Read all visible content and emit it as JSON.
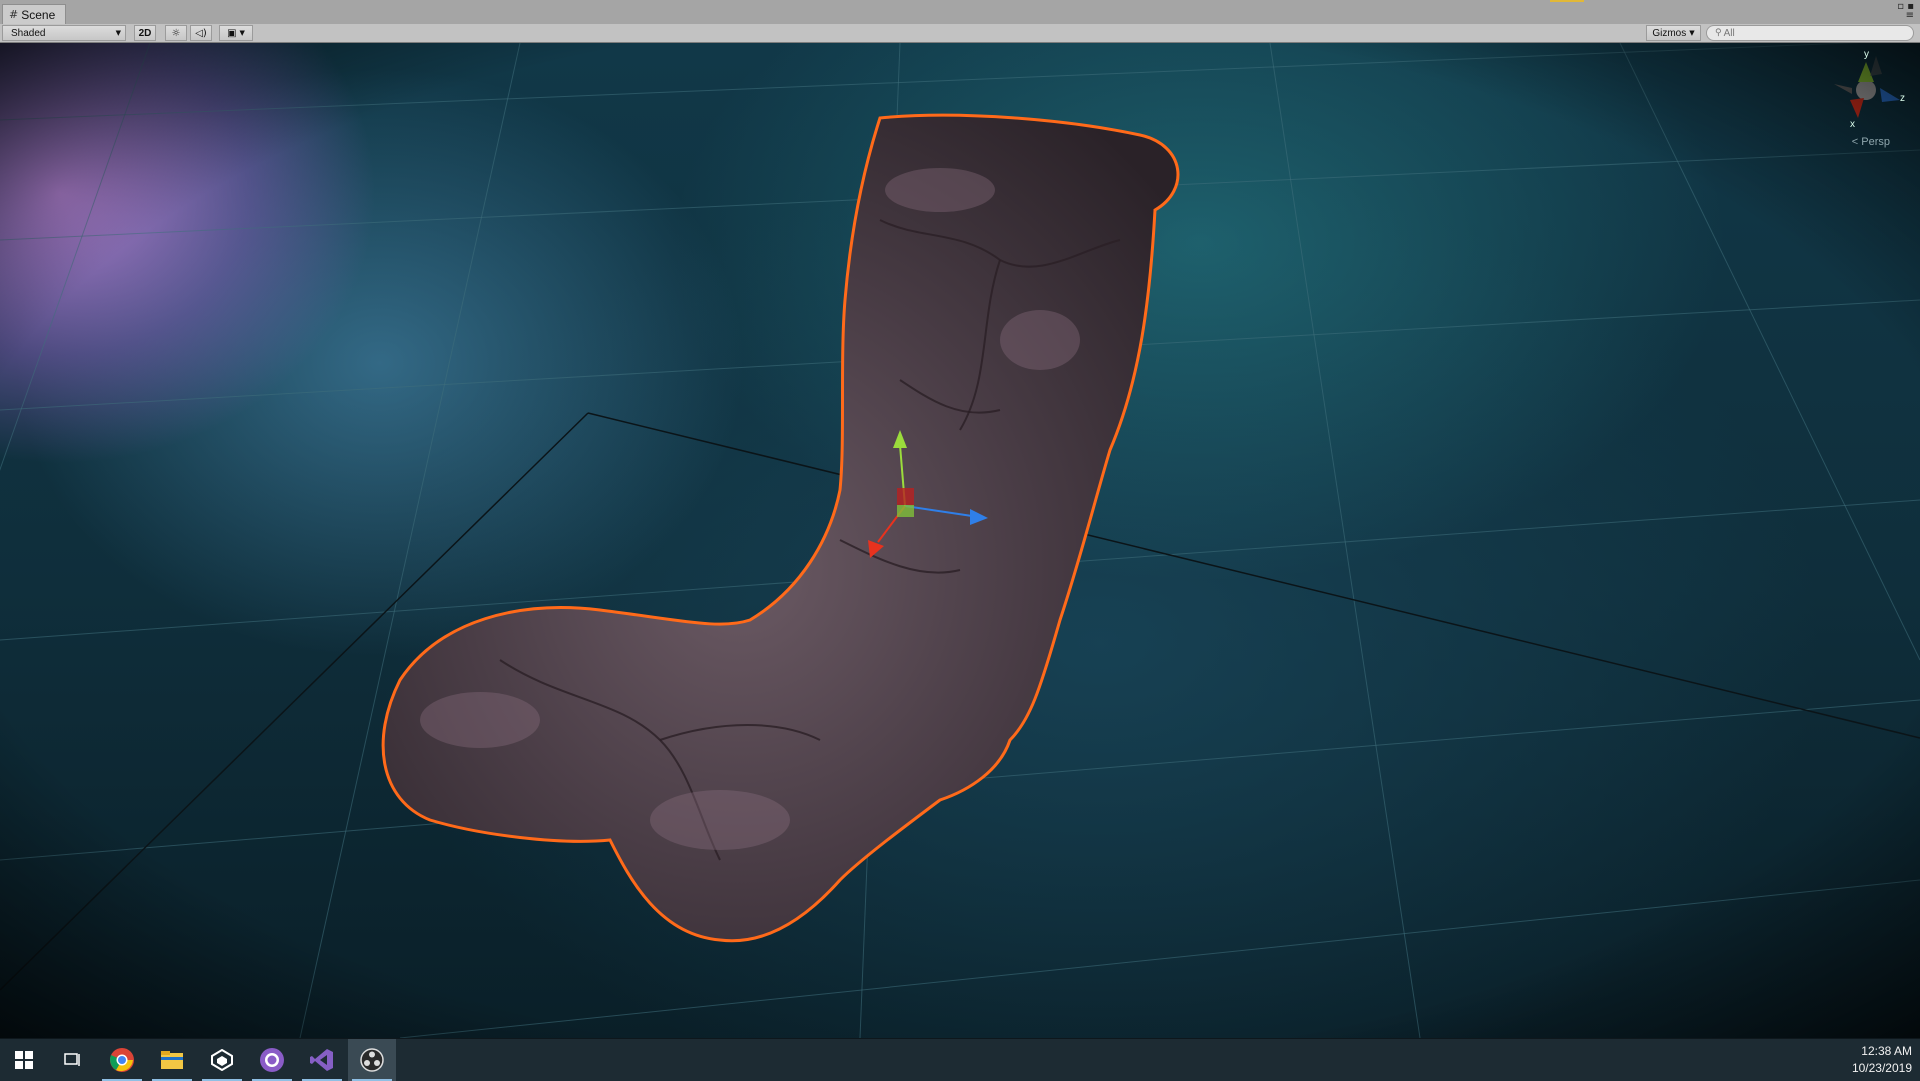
{
  "window": {
    "tab_label": "Scene",
    "tab_icon": "grid-icon"
  },
  "toolbar": {
    "shading_mode": "Shaded",
    "toggle_2d_label": "2D",
    "gizmos_label": "Gizmos",
    "search_placeholder": "All"
  },
  "scene": {
    "camera_mode_label": "Persp",
    "axis_labels": {
      "y": "y",
      "x": "x",
      "z": "z"
    },
    "selection_outline_color": "#ff6a1a",
    "axis_colors": {
      "x": "#e8321e",
      "y": "#9bdc3c",
      "z": "#2f7fe8"
    }
  },
  "taskbar": {
    "apps": [
      {
        "name": "start-button",
        "icon": "windows-logo-icon"
      },
      {
        "name": "task-view-button",
        "icon": "task-view-icon"
      },
      {
        "name": "chrome-app",
        "icon": "chrome-icon"
      },
      {
        "name": "file-explorer-app",
        "icon": "folder-icon"
      },
      {
        "name": "unity-app",
        "icon": "unity-icon"
      },
      {
        "name": "github-desktop-app",
        "icon": "github-icon"
      },
      {
        "name": "visual-studio-app",
        "icon": "visual-studio-icon"
      },
      {
        "name": "obs-app",
        "icon": "obs-icon"
      }
    ],
    "time": "12:38 AM",
    "date": "10/23/2019"
  }
}
